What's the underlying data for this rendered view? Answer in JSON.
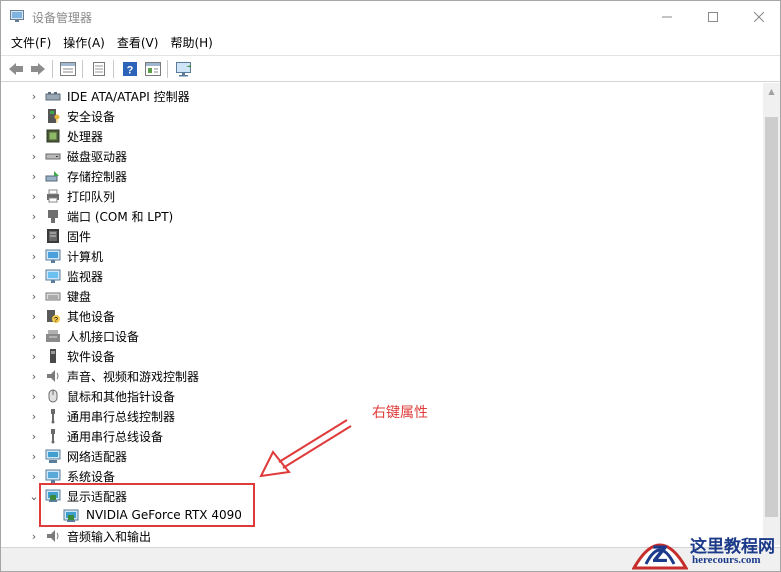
{
  "window": {
    "title": "设备管理器",
    "controls": {
      "minimize": "minimize-icon",
      "maximize": "maximize-icon",
      "close": "close-icon"
    }
  },
  "menubar": {
    "items": [
      "文件(F)",
      "操作(A)",
      "查看(V)",
      "帮助(H)"
    ]
  },
  "toolbar": {
    "buttons": [
      "back-icon",
      "forward-icon",
      "properties-grid-icon",
      "print-icon",
      "help-icon",
      "view-icon",
      "scan-monitor-icon"
    ]
  },
  "tree": {
    "categories": [
      {
        "label": "IDE ATA/ATAPI 控制器",
        "icon": "ide-controller-icon",
        "expanded": false
      },
      {
        "label": "安全设备",
        "icon": "security-device-icon",
        "expanded": false
      },
      {
        "label": "处理器",
        "icon": "processor-icon",
        "expanded": false
      },
      {
        "label": "磁盘驱动器",
        "icon": "disk-drive-icon",
        "expanded": false
      },
      {
        "label": "存储控制器",
        "icon": "storage-controller-icon",
        "expanded": false
      },
      {
        "label": "打印队列",
        "icon": "printer-icon",
        "expanded": false
      },
      {
        "label": "端口 (COM 和 LPT)",
        "icon": "port-icon",
        "expanded": false
      },
      {
        "label": "固件",
        "icon": "firmware-icon",
        "expanded": false
      },
      {
        "label": "计算机",
        "icon": "computer-icon",
        "expanded": false
      },
      {
        "label": "监视器",
        "icon": "monitor-icon",
        "expanded": false
      },
      {
        "label": "键盘",
        "icon": "keyboard-icon",
        "expanded": false
      },
      {
        "label": "其他设备",
        "icon": "other-device-icon",
        "expanded": false
      },
      {
        "label": "人机接口设备",
        "icon": "hid-icon",
        "expanded": false
      },
      {
        "label": "软件设备",
        "icon": "software-device-icon",
        "expanded": false
      },
      {
        "label": "声音、视频和游戏控制器",
        "icon": "audio-icon",
        "expanded": false
      },
      {
        "label": "鼠标和其他指针设备",
        "icon": "mouse-icon",
        "expanded": false
      },
      {
        "label": "通用串行总线控制器",
        "icon": "usb-controller-icon",
        "expanded": false
      },
      {
        "label": "通用串行总线设备",
        "icon": "usb-device-icon",
        "expanded": false
      },
      {
        "label": "网络适配器",
        "icon": "network-adapter-icon",
        "expanded": false
      },
      {
        "label": "系统设备",
        "icon": "system-device-icon",
        "expanded": false
      },
      {
        "label": "显示适配器",
        "icon": "display-adapter-icon",
        "expanded": true
      },
      {
        "label": "音频输入和输出",
        "icon": "audio-io-icon",
        "expanded": false
      }
    ],
    "display_adapter_child": {
      "label": "NVIDIA GeForce RTX 4090",
      "icon": "display-adapter-icon"
    }
  },
  "annotation": {
    "text": "右键属性",
    "color": "#e03b3b"
  },
  "watermark": {
    "title": "这里教程网",
    "url": "herecours.com",
    "color": "#1c3a8a"
  }
}
